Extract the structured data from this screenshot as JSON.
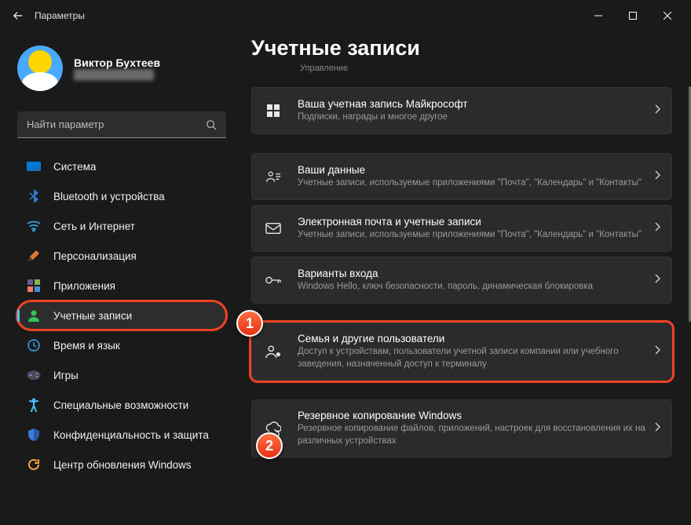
{
  "titlebar": {
    "title": "Параметры"
  },
  "profile": {
    "name": "Виктор Бухтеев",
    "sub": "████████████"
  },
  "search": {
    "placeholder": "Найти параметр"
  },
  "nav": {
    "items": [
      {
        "key": "system",
        "label": "Система"
      },
      {
        "key": "bluetooth",
        "label": "Bluetooth и устройства"
      },
      {
        "key": "network",
        "label": "Сеть и Интернет"
      },
      {
        "key": "personalization",
        "label": "Персонализация"
      },
      {
        "key": "apps",
        "label": "Приложения"
      },
      {
        "key": "accounts",
        "label": "Учетные записи",
        "selected": true,
        "highlighted": true
      },
      {
        "key": "time",
        "label": "Время и язык"
      },
      {
        "key": "gaming",
        "label": "Игры"
      },
      {
        "key": "accessibility",
        "label": "Специальные возможности"
      },
      {
        "key": "privacy",
        "label": "Конфиденциальность и защита"
      },
      {
        "key": "update",
        "label": "Центр обновления Windows"
      }
    ]
  },
  "page": {
    "title": "Учетные записи",
    "breadcrumb": "Управление",
    "cards": [
      {
        "key": "ms-account",
        "title": "Ваша учетная запись Майкрософт",
        "desc": "Подписки, награды и многое другое"
      },
      {
        "key": "your-info",
        "title": "Ваши данные",
        "desc": "Учетные записи, используемые приложениями \"Почта\", \"Календарь\" и \"Контакты\""
      },
      {
        "key": "email",
        "title": "Электронная почта и учетные записи",
        "desc": "Учетные записи, используемые приложениями \"Почта\", \"Календарь\" и \"Контакты\""
      },
      {
        "key": "signin",
        "title": "Варианты входа",
        "desc": "Windows Hello, ключ безопасности, пароль, динамическая блокировка"
      },
      {
        "key": "family",
        "title": "Семья и другие пользователи",
        "desc": "Доступ к устройствам, пользователи учетной записи компании или учебного заведения, назначенный доступ к терминалу",
        "highlighted": true
      },
      {
        "key": "backup",
        "title": "Резервное копирование Windows",
        "desc": "Резервное копирование файлов, приложений, настроек для восстановления их на различных устройствах"
      }
    ]
  },
  "markers": {
    "1": "1",
    "2": "2"
  }
}
